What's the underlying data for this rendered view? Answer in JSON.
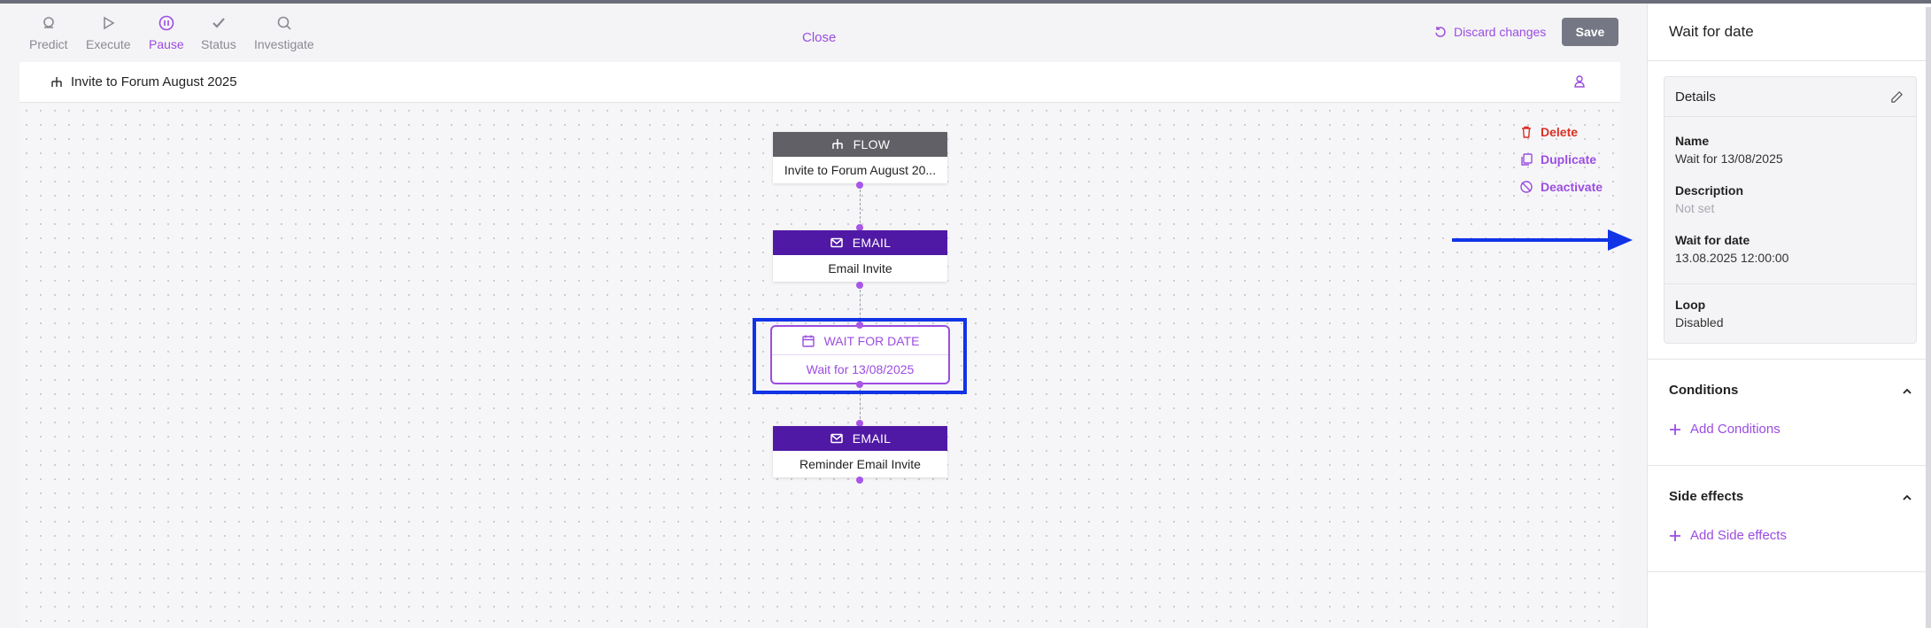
{
  "toolbar": {
    "tools": [
      {
        "label": "Predict",
        "icon": "cloud-icon",
        "active": false
      },
      {
        "label": "Execute",
        "icon": "play-icon",
        "active": false
      },
      {
        "label": "Pause",
        "icon": "pause-icon",
        "active": true
      },
      {
        "label": "Status",
        "icon": "check-icon",
        "active": false
      },
      {
        "label": "Investigate",
        "icon": "search-icon",
        "active": false
      }
    ],
    "close": "Close",
    "discard": "Discard changes",
    "save": "Save"
  },
  "flow": {
    "title": "Invite to Forum August 2025"
  },
  "nodes": {
    "flow_node": {
      "type": "FLOW",
      "label": "Invite to Forum August 20..."
    },
    "email1": {
      "type": "EMAIL",
      "label": "Email Invite"
    },
    "wait": {
      "type": "WAIT FOR DATE",
      "label": "Wait for 13/08/2025"
    },
    "email2": {
      "type": "EMAIL",
      "label": "Reminder Email Invite"
    }
  },
  "actions": {
    "delete": "Delete",
    "duplicate": "Duplicate",
    "deactivate": "Deactivate"
  },
  "panel": {
    "title": "Wait for date",
    "details": {
      "heading": "Details",
      "name_label": "Name",
      "name_value": "Wait for 13/08/2025",
      "description_label": "Description",
      "description_value": "Not set",
      "wait_label": "Wait for date",
      "wait_value": "13.08.2025 12:00:00",
      "loop_label": "Loop",
      "loop_value": "Disabled"
    },
    "conditions": {
      "title": "Conditions",
      "add": "Add Conditions"
    },
    "side_effects": {
      "title": "Side effects",
      "add": "Add Side effects"
    }
  },
  "colors": {
    "accent": "#9b4de0",
    "email_header": "#5019a5",
    "flow_header": "#606066",
    "highlight": "#1034e6",
    "delete": "#d93025"
  }
}
